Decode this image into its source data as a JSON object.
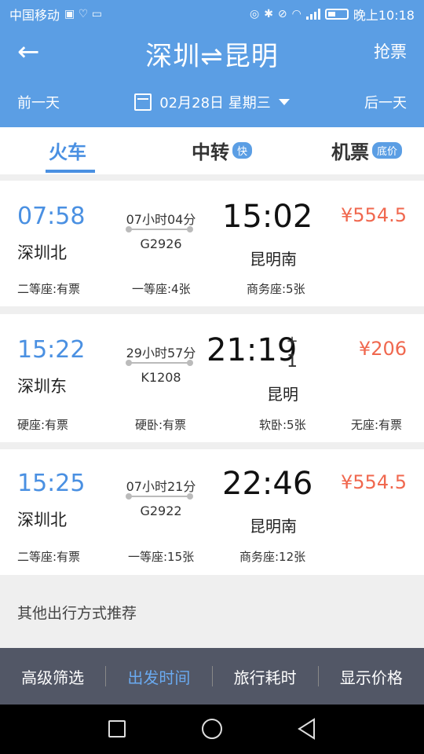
{
  "statusbar": {
    "carrier": "中国移动",
    "time": "晚上10:18",
    "icons": [
      "nfc-icon",
      "bluetooth-icon",
      "mute-icon",
      "wifi-icon",
      "4g-icon",
      "signal-icon",
      "battery-icon"
    ]
  },
  "header": {
    "back_icon": "←",
    "title": "深圳⇌昆明",
    "grab_label": "抢票",
    "prev_day": "前一天",
    "date": "02月28日 星期三",
    "next_day": "后一天"
  },
  "tabs": [
    {
      "label": "火车",
      "badge": ""
    },
    {
      "label": "中转",
      "badge": "快"
    },
    {
      "label": "机票",
      "badge": "底价"
    }
  ],
  "trains": [
    {
      "dep_time": "07:58",
      "dep_station": "深圳北",
      "duration": "07小时04分",
      "number": "G2926",
      "arr_time": "15:02",
      "arr_station": "昆明南",
      "next_day": "",
      "price": "¥554.5",
      "seats": [
        "二等座:有票",
        "一等座:4张",
        "商务座:5张"
      ]
    },
    {
      "dep_time": "15:22",
      "dep_station": "深圳东",
      "duration": "29小时57分",
      "number": "K1208",
      "arr_time": "21:19",
      "arr_station": "昆明",
      "next_day_plus": "+",
      "next_day_num": "1",
      "price": "¥206",
      "seats": [
        "硬座:有票",
        "硬卧:有票",
        "软卧:5张",
        "无座:有票"
      ]
    },
    {
      "dep_time": "15:25",
      "dep_station": "深圳北",
      "duration": "07小时21分",
      "number": "G2922",
      "arr_time": "22:46",
      "arr_station": "昆明南",
      "next_day": "",
      "price": "¥554.5",
      "seats": [
        "二等座:有票",
        "一等座:15张",
        "商务座:12张"
      ]
    }
  ],
  "other_recommend": "其他出行方式推荐",
  "bottom_bar": [
    "高级筛选",
    "出发时间",
    "旅行耗时",
    "显示价格"
  ],
  "colors": {
    "accent": "#5b9ee4",
    "price": "#f0684f",
    "active_tab": "#4a90e2",
    "bottom_bar": "#525766"
  }
}
